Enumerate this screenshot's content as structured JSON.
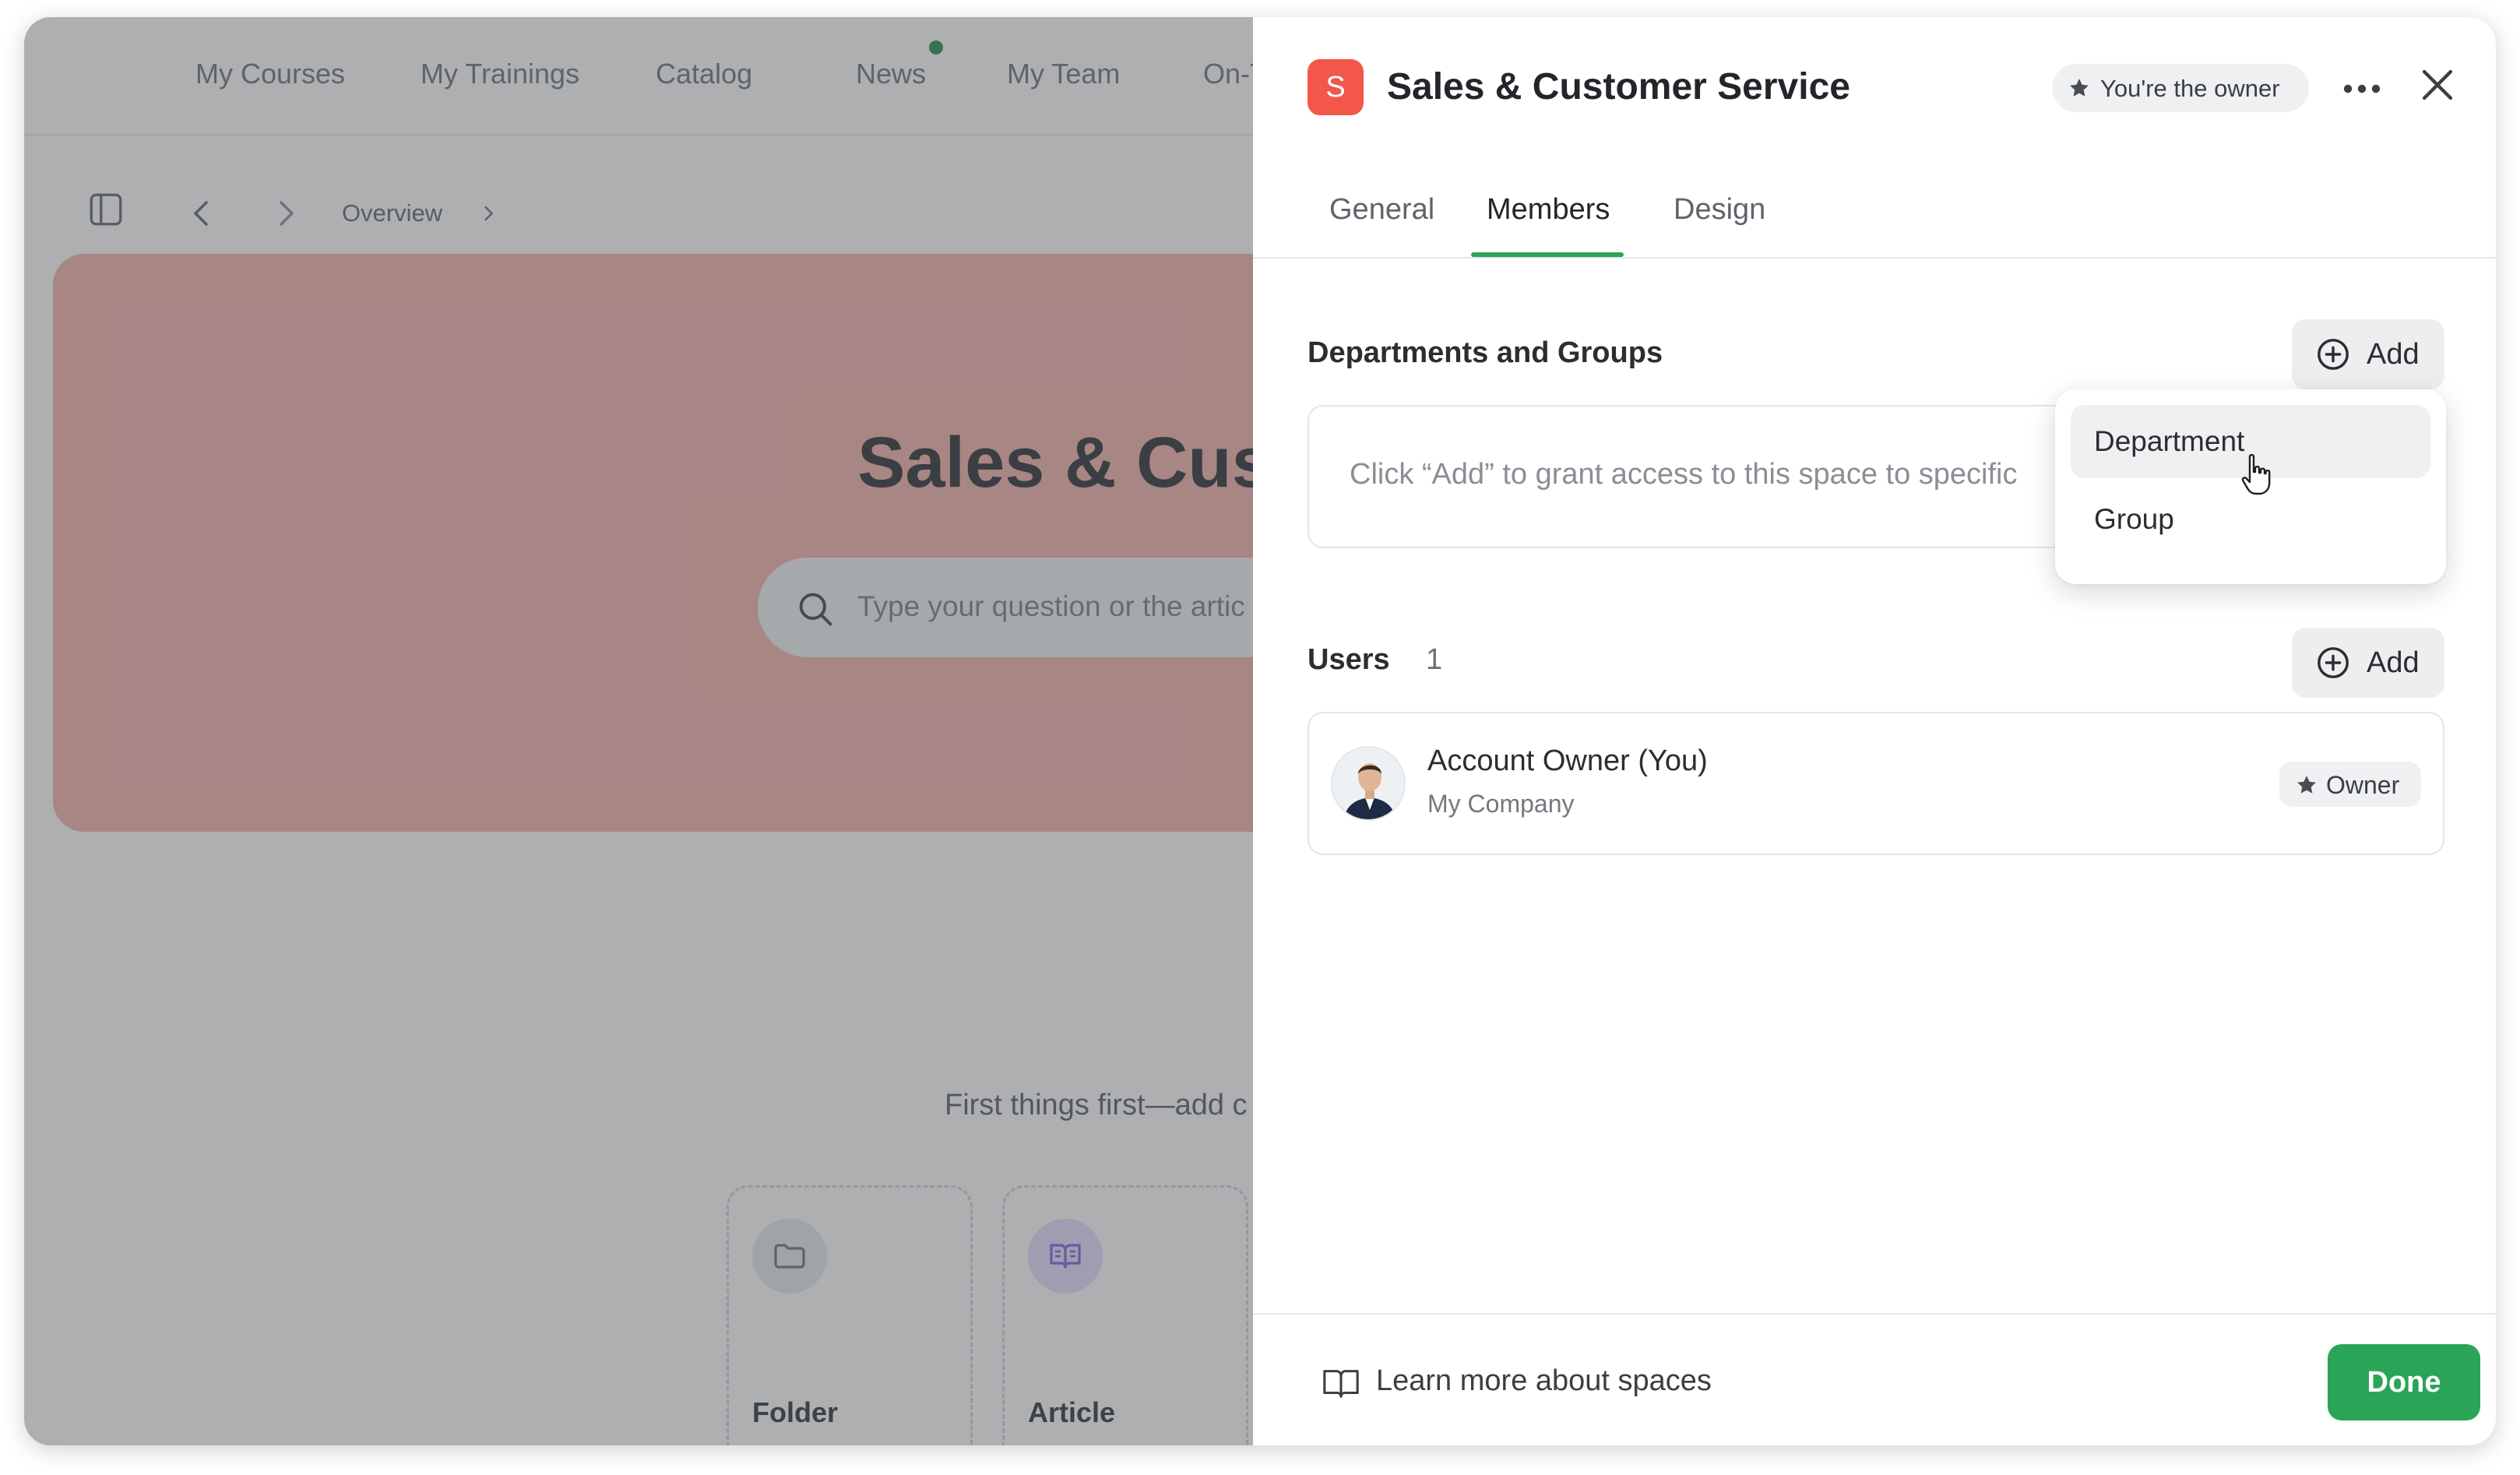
{
  "background": {
    "nav": {
      "items": [
        {
          "label": "My Courses"
        },
        {
          "label": "My Trainings"
        },
        {
          "label": "Catalog"
        },
        {
          "label": "News"
        },
        {
          "label": "My Team"
        },
        {
          "label": "On-T"
        }
      ]
    },
    "breadcrumb": {
      "label": "Overview"
    },
    "hero": {
      "title": "Sales & Cust",
      "search_placeholder": "Type your question or the artic",
      "color": "#f3b1aa"
    },
    "first_things": "First things first—add c",
    "tiles": [
      {
        "label": "Folder",
        "icon": "folder-icon"
      },
      {
        "label": "Article",
        "icon": "book-icon"
      }
    ]
  },
  "panel": {
    "badge_letter": "S",
    "badge_color": "#f2574a",
    "title": "Sales & Customer Service",
    "owner_chip": "You're the owner",
    "tabs": [
      {
        "label": "General"
      },
      {
        "label": "Members",
        "active": true
      },
      {
        "label": "Design"
      }
    ],
    "departments": {
      "title": "Departments and Groups",
      "add_label": "Add",
      "empty_text": "Click “Add” to grant access to this space to specific"
    },
    "dropdown": {
      "items": [
        {
          "label": "Department",
          "hover": true
        },
        {
          "label": "Group"
        }
      ]
    },
    "users": {
      "title": "Users",
      "count": "1",
      "add_label": "Add",
      "list": [
        {
          "name": "Account Owner (You)",
          "org": "My Company",
          "role": "Owner"
        }
      ]
    },
    "footer": {
      "learn_more": "Learn more about spaces",
      "done_label": "Done",
      "accent": "#2aa557"
    }
  }
}
